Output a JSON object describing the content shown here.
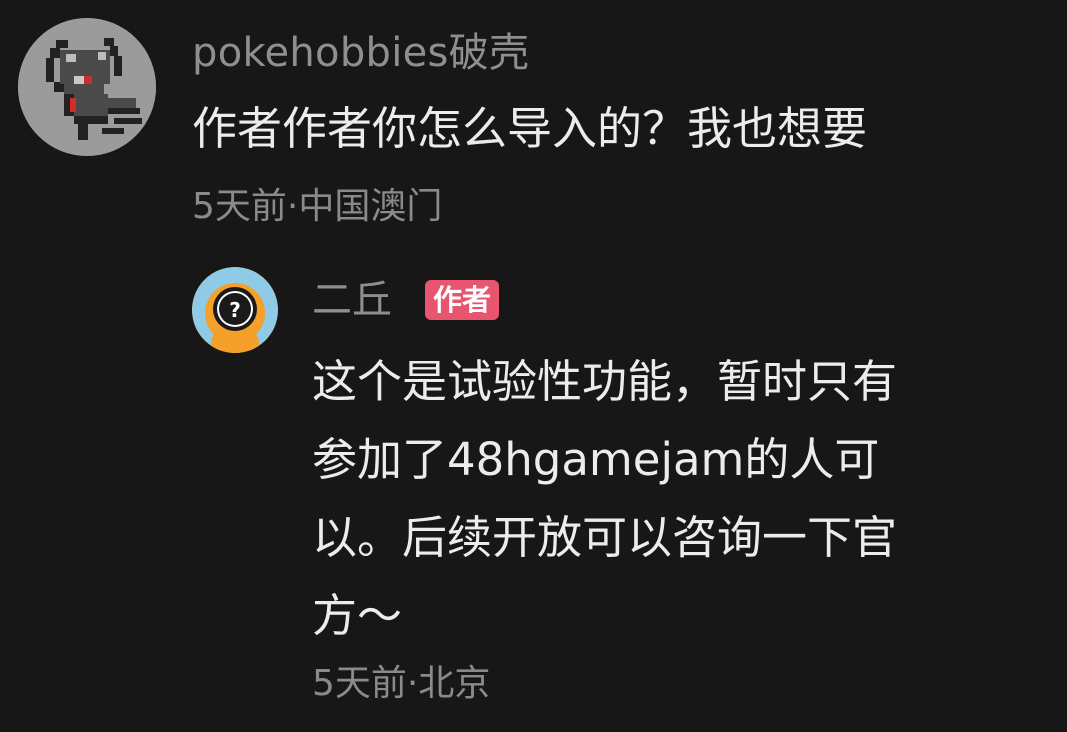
{
  "comments": [
    {
      "username": "pokehobbies破壳",
      "content": "作者作者你怎么导入的？我也想要",
      "meta": "5天前·中国澳门",
      "avatar_icon": "pixel-ghost-avatar-icon"
    }
  ],
  "reply": {
    "username": "二丘",
    "badge": "作者",
    "content": "这个是试验性功能，暂时只有\n参加了48hgamejam的人可\n以。后续开放可以咨询一下官\n方～",
    "meta": "5天前·北京",
    "avatar_icon": "question-mark-avatar-icon"
  },
  "colors": {
    "background": "#171717",
    "badge": "#e7566e",
    "reply_avatar": "#f5a02a"
  }
}
